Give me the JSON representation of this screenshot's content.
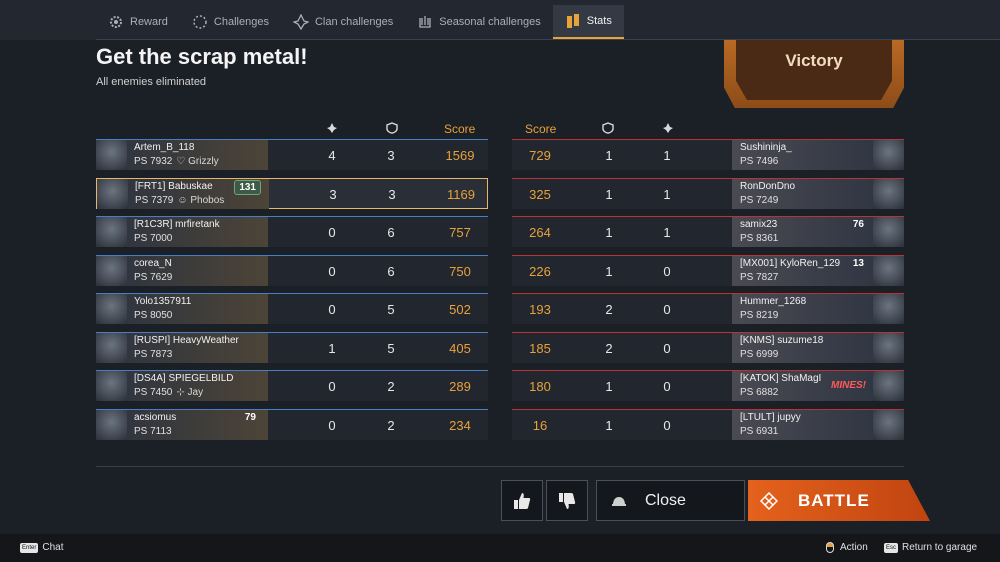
{
  "tabs": [
    {
      "label": "Reward",
      "icon": "gear-icon"
    },
    {
      "label": "Challenges",
      "icon": "challenge-icon"
    },
    {
      "label": "Clan challenges",
      "icon": "clan-icon"
    },
    {
      "label": "Seasonal challenges",
      "icon": "seasonal-icon"
    },
    {
      "label": "Stats",
      "icon": "stats-icon",
      "active": true
    }
  ],
  "title": "Get the scrap metal!",
  "subtitle": "All enemies eliminated",
  "result": "Victory",
  "headers": {
    "score": "Score"
  },
  "team_left": [
    {
      "name": "Artem_B_118",
      "ps": "PS 7932",
      "clan": "♡ Grizzly",
      "kills": "4",
      "assists": "3",
      "score": "1569"
    },
    {
      "name": "[FRT1] Babuskae",
      "ps": "PS 7379",
      "clan": "☺ Phobos",
      "level": "131",
      "kills": "3",
      "assists": "3",
      "score": "1169"
    },
    {
      "name": "[R1C3R] mrfiretank",
      "ps": "PS 7000",
      "clan": "",
      "kills": "0",
      "assists": "6",
      "score": "757"
    },
    {
      "name": "corea_N",
      "ps": "PS 7629",
      "clan": "",
      "kills": "0",
      "assists": "6",
      "score": "750"
    },
    {
      "name": "Yolo1357911",
      "ps": "PS 8050",
      "clan": "",
      "kills": "0",
      "assists": "5",
      "score": "502"
    },
    {
      "name": "[RUSPI] HeavyWeather",
      "ps": "PS 7873",
      "clan": "",
      "kills": "1",
      "assists": "5",
      "score": "405"
    },
    {
      "name": "[DS4A] SPIEGELBILD",
      "ps": "PS 7450",
      "clan": "⊹ Jay",
      "kills": "0",
      "assists": "2",
      "score": "289"
    },
    {
      "name": "acsiomus",
      "ps": "PS 7113",
      "clan": "",
      "level": "79",
      "kills": "0",
      "assists": "2",
      "score": "234"
    }
  ],
  "team_right": [
    {
      "name": "Sushininja_",
      "ps": "PS 7496",
      "score": "729",
      "assists": "1",
      "kills": "1"
    },
    {
      "name": "RonDonDno",
      "ps": "PS 7249",
      "score": "325",
      "assists": "1",
      "kills": "1"
    },
    {
      "name": "samix23",
      "ps": "PS 8361",
      "level": "76",
      "score": "264",
      "assists": "1",
      "kills": "1"
    },
    {
      "name": "[MX001] KyloRen_129",
      "ps": "PS 7827",
      "level": "13",
      "score": "226",
      "assists": "1",
      "kills": "0"
    },
    {
      "name": "Hummer_1268",
      "ps": "PS 8219",
      "score": "193",
      "assists": "2",
      "kills": "0"
    },
    {
      "name": "[KNMS] suzume18",
      "ps": "PS 6999",
      "score": "185",
      "assists": "2",
      "kills": "0"
    },
    {
      "name": "[KATOK] ShaMagI",
      "ps": "PS 6882",
      "badge": "MINES!",
      "score": "180",
      "assists": "1",
      "kills": "0"
    },
    {
      "name": "[LTULT] jupyy",
      "ps": "PS 6931",
      "score": "16",
      "assists": "1",
      "kills": "0"
    }
  ],
  "buttons": {
    "close": "Close",
    "battle": "BATTLE"
  },
  "footer": {
    "chat_key": "Enter",
    "chat": "Chat",
    "action": "Action",
    "return_key": "Esc",
    "return": "Return to garage"
  },
  "colors": {
    "accent": "#e8a23a",
    "battle": "#e4621c",
    "team_left": "#4a7ec4",
    "team_right": "#b83434"
  }
}
